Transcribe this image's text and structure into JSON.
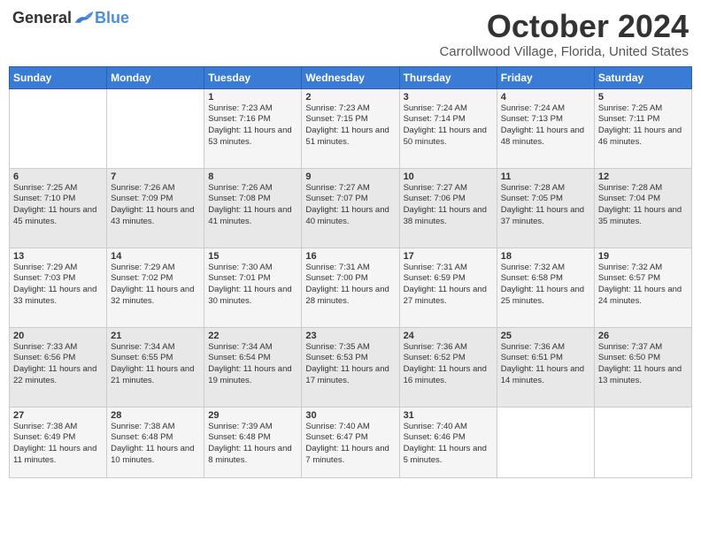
{
  "header": {
    "logo": {
      "general": "General",
      "blue": "Blue"
    },
    "title": "October 2024",
    "location": "Carrollwood Village, Florida, United States"
  },
  "days_of_week": [
    "Sunday",
    "Monday",
    "Tuesday",
    "Wednesday",
    "Thursday",
    "Friday",
    "Saturday"
  ],
  "weeks": [
    [
      {
        "day": "",
        "sunrise": "",
        "sunset": "",
        "daylight": ""
      },
      {
        "day": "",
        "sunrise": "",
        "sunset": "",
        "daylight": ""
      },
      {
        "day": "1",
        "sunrise": "Sunrise: 7:23 AM",
        "sunset": "Sunset: 7:16 PM",
        "daylight": "Daylight: 11 hours and 53 minutes."
      },
      {
        "day": "2",
        "sunrise": "Sunrise: 7:23 AM",
        "sunset": "Sunset: 7:15 PM",
        "daylight": "Daylight: 11 hours and 51 minutes."
      },
      {
        "day": "3",
        "sunrise": "Sunrise: 7:24 AM",
        "sunset": "Sunset: 7:14 PM",
        "daylight": "Daylight: 11 hours and 50 minutes."
      },
      {
        "day": "4",
        "sunrise": "Sunrise: 7:24 AM",
        "sunset": "Sunset: 7:13 PM",
        "daylight": "Daylight: 11 hours and 48 minutes."
      },
      {
        "day": "5",
        "sunrise": "Sunrise: 7:25 AM",
        "sunset": "Sunset: 7:11 PM",
        "daylight": "Daylight: 11 hours and 46 minutes."
      }
    ],
    [
      {
        "day": "6",
        "sunrise": "Sunrise: 7:25 AM",
        "sunset": "Sunset: 7:10 PM",
        "daylight": "Daylight: 11 hours and 45 minutes."
      },
      {
        "day": "7",
        "sunrise": "Sunrise: 7:26 AM",
        "sunset": "Sunset: 7:09 PM",
        "daylight": "Daylight: 11 hours and 43 minutes."
      },
      {
        "day": "8",
        "sunrise": "Sunrise: 7:26 AM",
        "sunset": "Sunset: 7:08 PM",
        "daylight": "Daylight: 11 hours and 41 minutes."
      },
      {
        "day": "9",
        "sunrise": "Sunrise: 7:27 AM",
        "sunset": "Sunset: 7:07 PM",
        "daylight": "Daylight: 11 hours and 40 minutes."
      },
      {
        "day": "10",
        "sunrise": "Sunrise: 7:27 AM",
        "sunset": "Sunset: 7:06 PM",
        "daylight": "Daylight: 11 hours and 38 minutes."
      },
      {
        "day": "11",
        "sunrise": "Sunrise: 7:28 AM",
        "sunset": "Sunset: 7:05 PM",
        "daylight": "Daylight: 11 hours and 37 minutes."
      },
      {
        "day": "12",
        "sunrise": "Sunrise: 7:28 AM",
        "sunset": "Sunset: 7:04 PM",
        "daylight": "Daylight: 11 hours and 35 minutes."
      }
    ],
    [
      {
        "day": "13",
        "sunrise": "Sunrise: 7:29 AM",
        "sunset": "Sunset: 7:03 PM",
        "daylight": "Daylight: 11 hours and 33 minutes."
      },
      {
        "day": "14",
        "sunrise": "Sunrise: 7:29 AM",
        "sunset": "Sunset: 7:02 PM",
        "daylight": "Daylight: 11 hours and 32 minutes."
      },
      {
        "day": "15",
        "sunrise": "Sunrise: 7:30 AM",
        "sunset": "Sunset: 7:01 PM",
        "daylight": "Daylight: 11 hours and 30 minutes."
      },
      {
        "day": "16",
        "sunrise": "Sunrise: 7:31 AM",
        "sunset": "Sunset: 7:00 PM",
        "daylight": "Daylight: 11 hours and 28 minutes."
      },
      {
        "day": "17",
        "sunrise": "Sunrise: 7:31 AM",
        "sunset": "Sunset: 6:59 PM",
        "daylight": "Daylight: 11 hours and 27 minutes."
      },
      {
        "day": "18",
        "sunrise": "Sunrise: 7:32 AM",
        "sunset": "Sunset: 6:58 PM",
        "daylight": "Daylight: 11 hours and 25 minutes."
      },
      {
        "day": "19",
        "sunrise": "Sunrise: 7:32 AM",
        "sunset": "Sunset: 6:57 PM",
        "daylight": "Daylight: 11 hours and 24 minutes."
      }
    ],
    [
      {
        "day": "20",
        "sunrise": "Sunrise: 7:33 AM",
        "sunset": "Sunset: 6:56 PM",
        "daylight": "Daylight: 11 hours and 22 minutes."
      },
      {
        "day": "21",
        "sunrise": "Sunrise: 7:34 AM",
        "sunset": "Sunset: 6:55 PM",
        "daylight": "Daylight: 11 hours and 21 minutes."
      },
      {
        "day": "22",
        "sunrise": "Sunrise: 7:34 AM",
        "sunset": "Sunset: 6:54 PM",
        "daylight": "Daylight: 11 hours and 19 minutes."
      },
      {
        "day": "23",
        "sunrise": "Sunrise: 7:35 AM",
        "sunset": "Sunset: 6:53 PM",
        "daylight": "Daylight: 11 hours and 17 minutes."
      },
      {
        "day": "24",
        "sunrise": "Sunrise: 7:36 AM",
        "sunset": "Sunset: 6:52 PM",
        "daylight": "Daylight: 11 hours and 16 minutes."
      },
      {
        "day": "25",
        "sunrise": "Sunrise: 7:36 AM",
        "sunset": "Sunset: 6:51 PM",
        "daylight": "Daylight: 11 hours and 14 minutes."
      },
      {
        "day": "26",
        "sunrise": "Sunrise: 7:37 AM",
        "sunset": "Sunset: 6:50 PM",
        "daylight": "Daylight: 11 hours and 13 minutes."
      }
    ],
    [
      {
        "day": "27",
        "sunrise": "Sunrise: 7:38 AM",
        "sunset": "Sunset: 6:49 PM",
        "daylight": "Daylight: 11 hours and 11 minutes."
      },
      {
        "day": "28",
        "sunrise": "Sunrise: 7:38 AM",
        "sunset": "Sunset: 6:48 PM",
        "daylight": "Daylight: 11 hours and 10 minutes."
      },
      {
        "day": "29",
        "sunrise": "Sunrise: 7:39 AM",
        "sunset": "Sunset: 6:48 PM",
        "daylight": "Daylight: 11 hours and 8 minutes."
      },
      {
        "day": "30",
        "sunrise": "Sunrise: 7:40 AM",
        "sunset": "Sunset: 6:47 PM",
        "daylight": "Daylight: 11 hours and 7 minutes."
      },
      {
        "day": "31",
        "sunrise": "Sunrise: 7:40 AM",
        "sunset": "Sunset: 6:46 PM",
        "daylight": "Daylight: 11 hours and 5 minutes."
      },
      {
        "day": "",
        "sunrise": "",
        "sunset": "",
        "daylight": ""
      },
      {
        "day": "",
        "sunrise": "",
        "sunset": "",
        "daylight": ""
      }
    ]
  ]
}
